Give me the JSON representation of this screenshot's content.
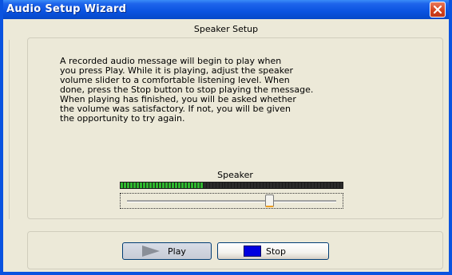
{
  "window": {
    "title": "Audio Setup Wizard"
  },
  "section": {
    "title": "Speaker Setup"
  },
  "description": "A recorded audio message will begin to play when\nyou press Play.  While it is playing, adjust the speaker\nvolume slider to a comfortable listening level.  When\ndone, press the Stop button to stop playing the message.\nWhen playing has finished, you will be asked whether\nthe volume was satisfactory.  If not, you will be given\nthe opportunity to try again.",
  "speaker": {
    "label": "Speaker",
    "level_fraction": 0.37,
    "volume_fraction": 0.68
  },
  "buttons": {
    "play_label": "Play",
    "stop_label": "Stop"
  },
  "colors": {
    "titlebar": "#0a53e0",
    "meter_on": "#2fb82f",
    "meter_off": "#2a2a2a",
    "stop_icon": "#0000e0",
    "close_button": "#d2401b"
  },
  "icons": {
    "close": "close-icon",
    "play": "play-icon",
    "stop": "stop-icon"
  }
}
